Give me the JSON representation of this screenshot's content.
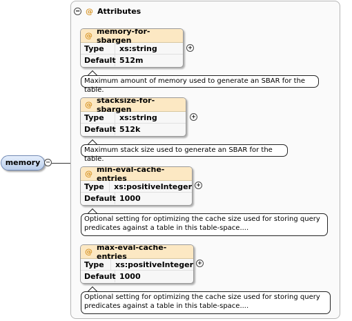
{
  "root": {
    "label": "memory",
    "collapse_symbol": "−"
  },
  "attributes_group": {
    "at_symbol": "@",
    "title": "Attributes",
    "collapse_symbol": "−"
  },
  "attributes": [
    {
      "name": "memory-for-sbargen",
      "type_label": "Type",
      "type": "xs:string",
      "default_label": "Default",
      "default": "512m",
      "expand_symbol": "+",
      "note": "Maximum amount of memory used to generate an SBAR for the table."
    },
    {
      "name": "stacksize-for-sbargen",
      "type_label": "Type",
      "type": "xs:string",
      "default_label": "Default",
      "default": "512k",
      "expand_symbol": "+",
      "note": "Maximum stack size used to generate an SBAR for the table."
    },
    {
      "name": "min-eval-cache-entries",
      "type_label": "Type",
      "type": "xs:positiveInteger",
      "default_label": "Default",
      "default": "1000",
      "expand_symbol": "+",
      "note": "Optional setting for optimizing the cache size used for storing query predicates against a table in this table-space...."
    },
    {
      "name": "max-eval-cache-entries",
      "type_label": "Type",
      "type": "xs:positiveInteger",
      "default_label": "Default",
      "default": "1000",
      "expand_symbol": "+",
      "note": "Optional setting for optimizing the cache size used for storing query predicates against a table in this table-space...."
    }
  ],
  "colors": {
    "root_fill": "#b8cdeb",
    "card_header": "#fce8c3",
    "at_symbol": "#d8962a"
  }
}
